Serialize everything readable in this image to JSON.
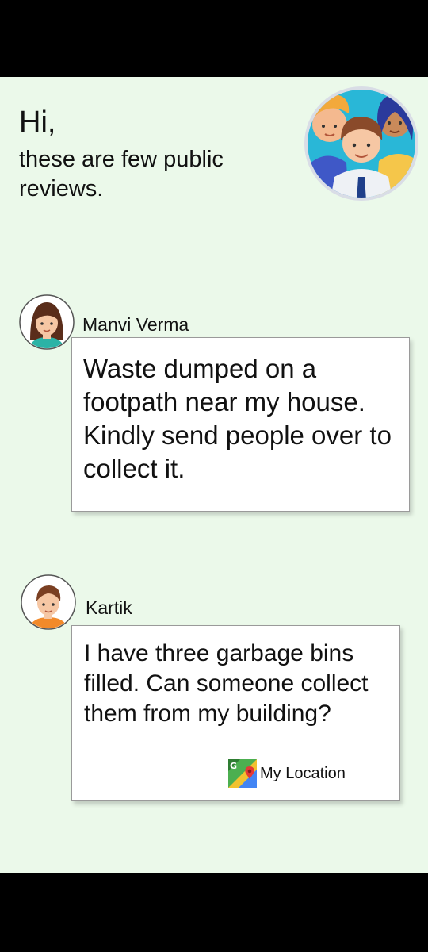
{
  "header": {
    "greeting": "Hi,",
    "subtitle": "these are few public reviews."
  },
  "reviews": [
    {
      "author": "Manvi Verma",
      "avatar_icon": "woman-avatar-icon",
      "text": "Waste dumped on a footpath near my house. Kindly send people over to collect it."
    },
    {
      "author": "Kartik",
      "avatar_icon": "man-avatar-icon",
      "text": "I have three garbage bins filled. Can someone collect them from my building?",
      "location_label": "My Location",
      "location_icon": "google-maps-icon"
    }
  ],
  "colors": {
    "background": "#ebf9ea",
    "card_border": "#9a9a9a",
    "system_bars": "#000000"
  }
}
